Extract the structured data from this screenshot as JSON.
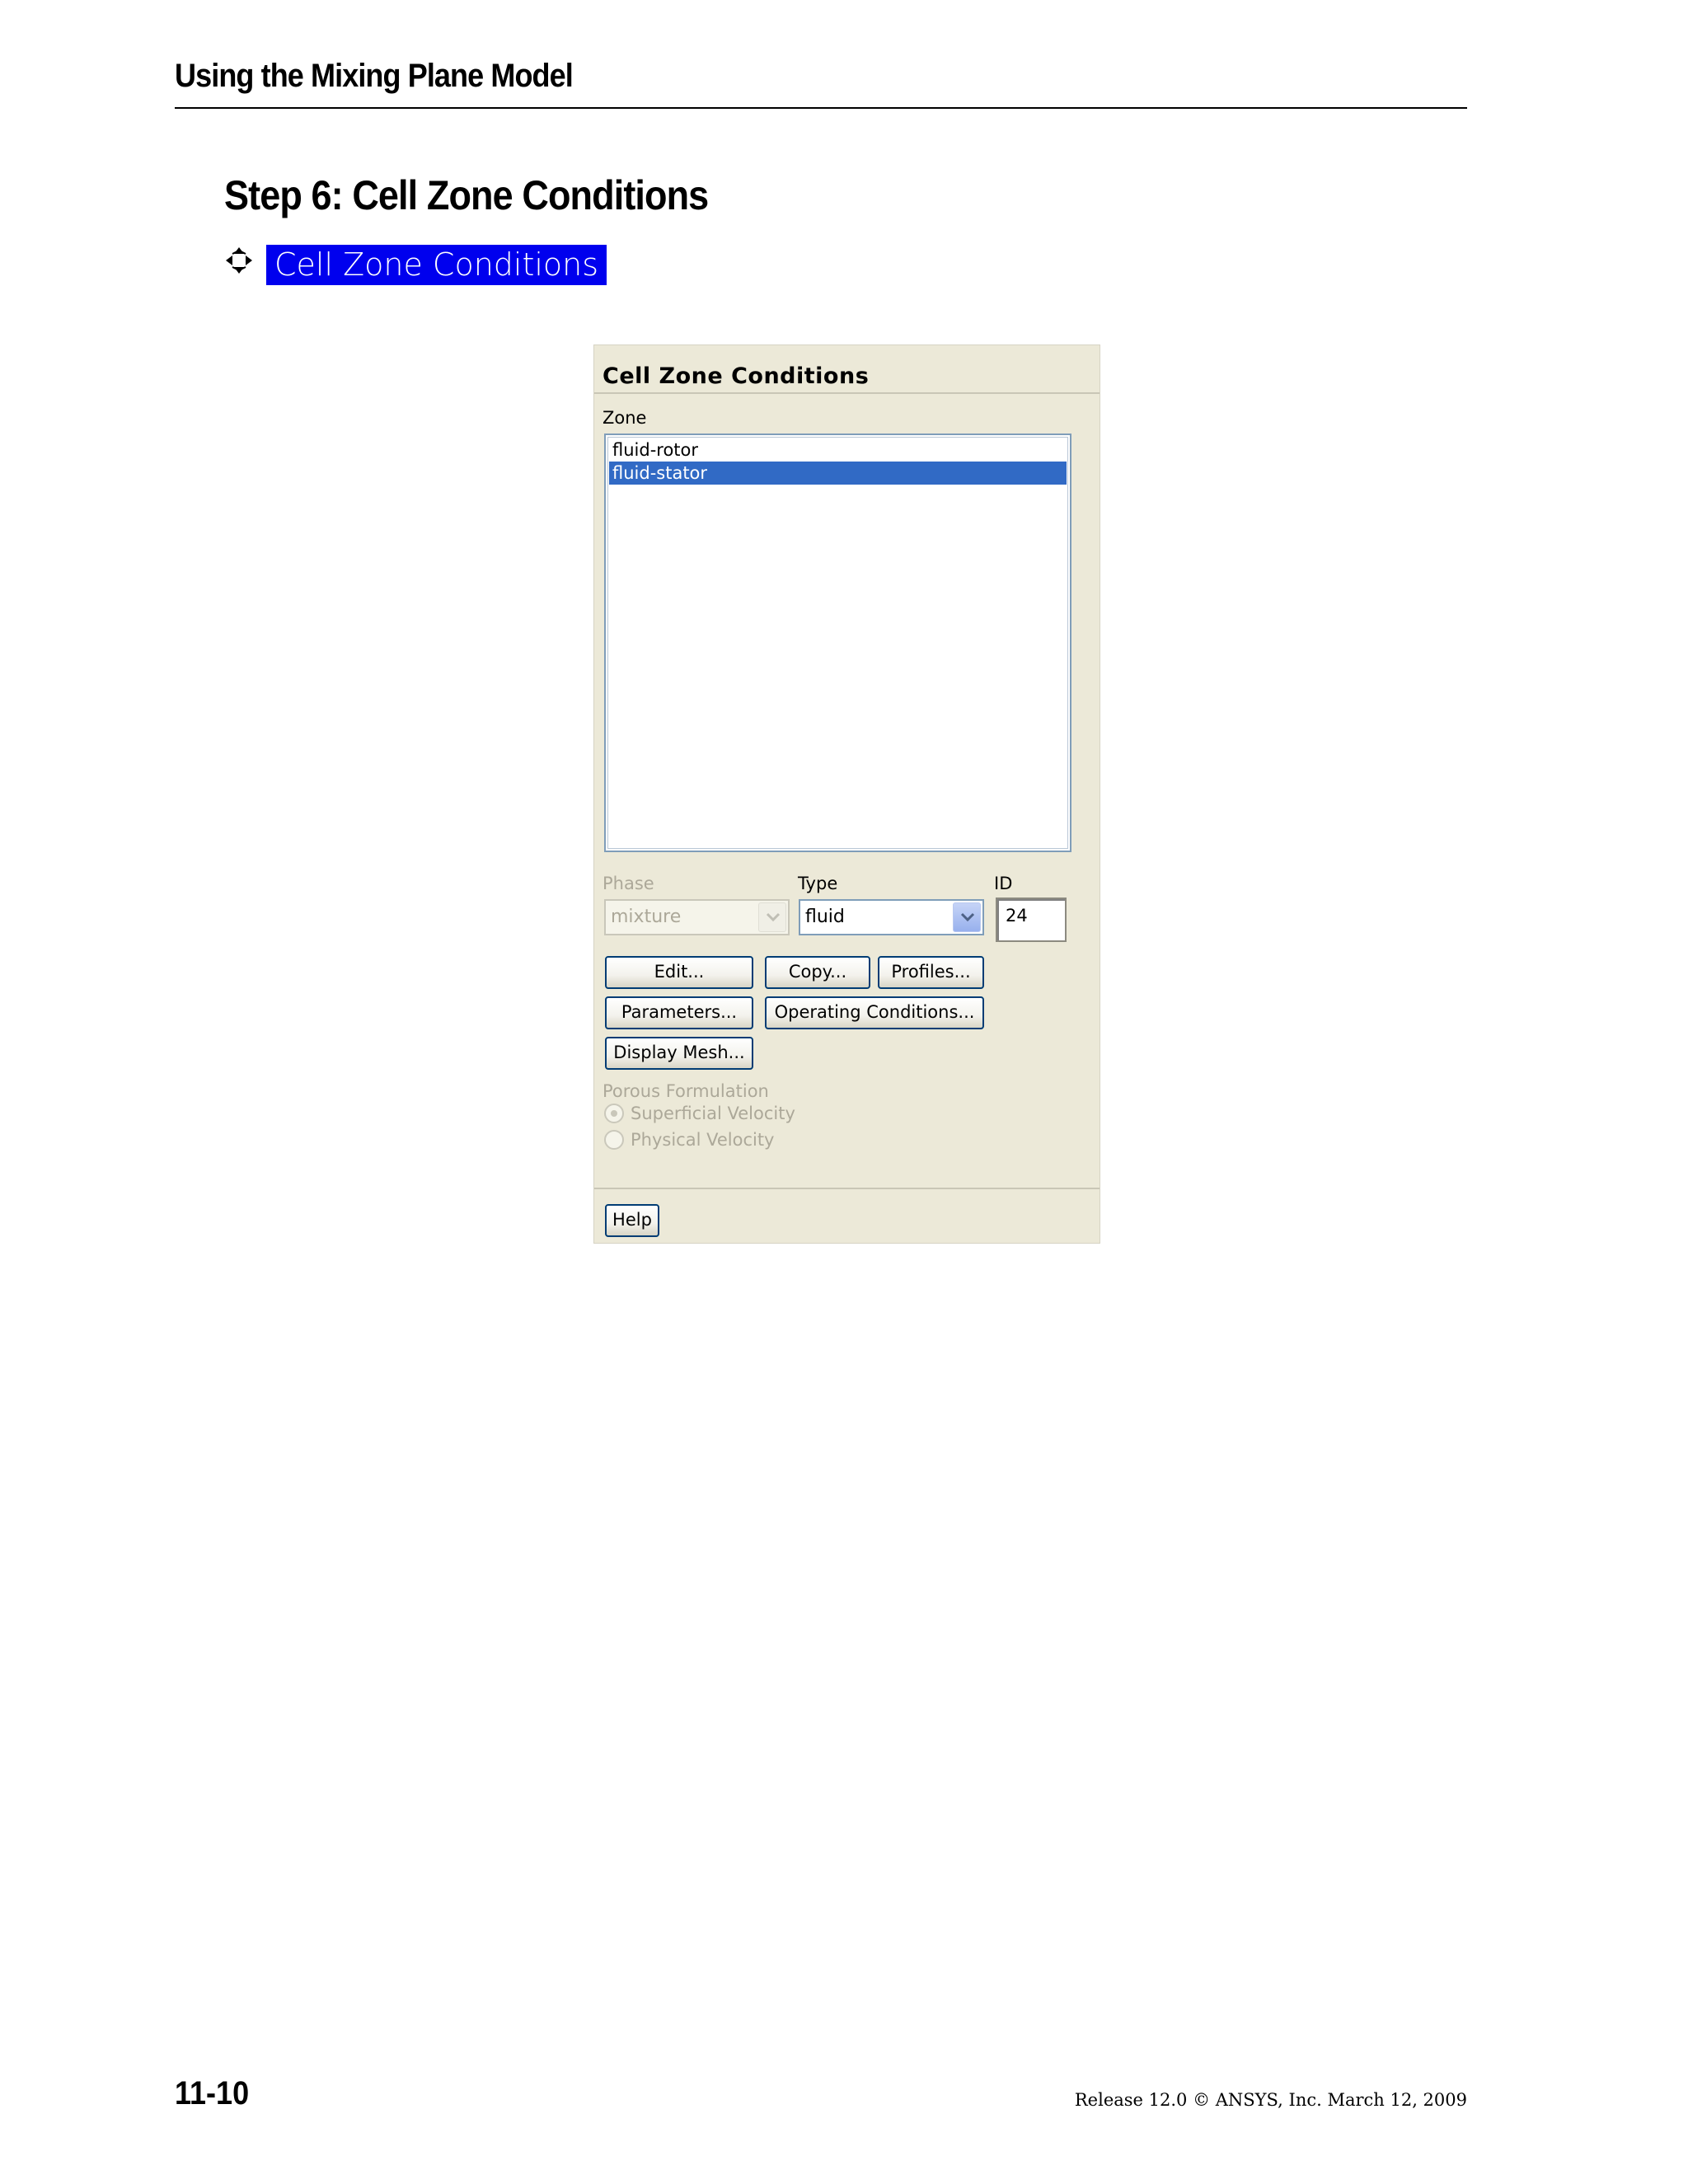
{
  "header": {
    "title": "Using the Mixing Plane Model"
  },
  "step": {
    "title": "Step 6: Cell Zone Conditions",
    "nav_link": "Cell Zone Conditions",
    "nav_icon": "tree-navigation-icon"
  },
  "dialog": {
    "title": "Cell Zone Conditions",
    "zone_label": "Zone",
    "zones": [
      "fluid-rotor",
      "fluid-stator"
    ],
    "selected_zone": "fluid-stator",
    "phase_label": "Phase",
    "phase_value": "mixture",
    "type_label": "Type",
    "type_value": "fluid",
    "id_label": "ID",
    "id_value": "24",
    "buttons": {
      "edit": "Edit...",
      "copy": "Copy...",
      "profiles": "Profiles...",
      "parameters": "Parameters...",
      "operating_conditions": "Operating Conditions...",
      "display_mesh": "Display Mesh...",
      "help": "Help"
    },
    "porous_label": "Porous Formulation",
    "porous_options": [
      "Superficial Velocity",
      "Physical Velocity"
    ],
    "porous_selected": "Superficial Velocity"
  },
  "footer": {
    "page_number": "11-10",
    "release": "Release 12.0 © ANSYS, Inc. March 12, 2009"
  }
}
